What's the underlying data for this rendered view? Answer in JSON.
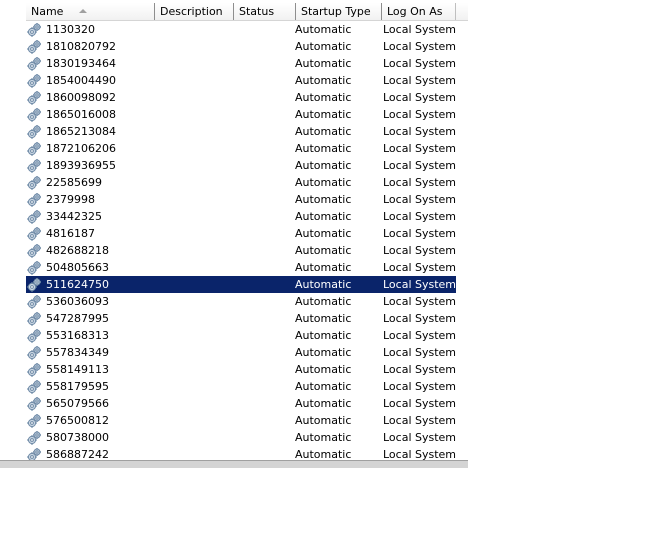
{
  "columns": {
    "name": "Name",
    "description": "Description",
    "status": "Status",
    "startup_type": "Startup Type",
    "log_on_as": "Log On As"
  },
  "selected_index": 15,
  "services": [
    {
      "name": "1130320",
      "description": "",
      "status": "",
      "startup_type": "Automatic",
      "log_on_as": "Local System"
    },
    {
      "name": "1810820792",
      "description": "",
      "status": "",
      "startup_type": "Automatic",
      "log_on_as": "Local System"
    },
    {
      "name": "1830193464",
      "description": "",
      "status": "",
      "startup_type": "Automatic",
      "log_on_as": "Local System"
    },
    {
      "name": "1854004490",
      "description": "",
      "status": "",
      "startup_type": "Automatic",
      "log_on_as": "Local System"
    },
    {
      "name": "1860098092",
      "description": "",
      "status": "",
      "startup_type": "Automatic",
      "log_on_as": "Local System"
    },
    {
      "name": "1865016008",
      "description": "",
      "status": "",
      "startup_type": "Automatic",
      "log_on_as": "Local System"
    },
    {
      "name": "1865213084",
      "description": "",
      "status": "",
      "startup_type": "Automatic",
      "log_on_as": "Local System"
    },
    {
      "name": "1872106206",
      "description": "",
      "status": "",
      "startup_type": "Automatic",
      "log_on_as": "Local System"
    },
    {
      "name": "1893936955",
      "description": "",
      "status": "",
      "startup_type": "Automatic",
      "log_on_as": "Local System"
    },
    {
      "name": "22585699",
      "description": "",
      "status": "",
      "startup_type": "Automatic",
      "log_on_as": "Local System"
    },
    {
      "name": "2379998",
      "description": "",
      "status": "",
      "startup_type": "Automatic",
      "log_on_as": "Local System"
    },
    {
      "name": "33442325",
      "description": "",
      "status": "",
      "startup_type": "Automatic",
      "log_on_as": "Local System"
    },
    {
      "name": "4816187",
      "description": "",
      "status": "",
      "startup_type": "Automatic",
      "log_on_as": "Local System"
    },
    {
      "name": "482688218",
      "description": "",
      "status": "",
      "startup_type": "Automatic",
      "log_on_as": "Local System"
    },
    {
      "name": "504805663",
      "description": "",
      "status": "",
      "startup_type": "Automatic",
      "log_on_as": "Local System"
    },
    {
      "name": "511624750",
      "description": "",
      "status": "",
      "startup_type": "Automatic",
      "log_on_as": "Local System"
    },
    {
      "name": "536036093",
      "description": "",
      "status": "",
      "startup_type": "Automatic",
      "log_on_as": "Local System"
    },
    {
      "name": "547287995",
      "description": "",
      "status": "",
      "startup_type": "Automatic",
      "log_on_as": "Local System"
    },
    {
      "name": "553168313",
      "description": "",
      "status": "",
      "startup_type": "Automatic",
      "log_on_as": "Local System"
    },
    {
      "name": "557834349",
      "description": "",
      "status": "",
      "startup_type": "Automatic",
      "log_on_as": "Local System"
    },
    {
      "name": "558149113",
      "description": "",
      "status": "",
      "startup_type": "Automatic",
      "log_on_as": "Local System"
    },
    {
      "name": "558179595",
      "description": "",
      "status": "",
      "startup_type": "Automatic",
      "log_on_as": "Local System"
    },
    {
      "name": "565079566",
      "description": "",
      "status": "",
      "startup_type": "Automatic",
      "log_on_as": "Local System"
    },
    {
      "name": "576500812",
      "description": "",
      "status": "",
      "startup_type": "Automatic",
      "log_on_as": "Local System"
    },
    {
      "name": "580738000",
      "description": "",
      "status": "",
      "startup_type": "Automatic",
      "log_on_as": "Local System"
    },
    {
      "name": "586887242",
      "description": "",
      "status": "",
      "startup_type": "Automatic",
      "log_on_as": "Local System"
    }
  ],
  "colors": {
    "selection": "#0a246a",
    "selection_text": "#ffffff"
  },
  "icons": {
    "service": "gear-icon",
    "sort": "sort-ascending-icon"
  }
}
